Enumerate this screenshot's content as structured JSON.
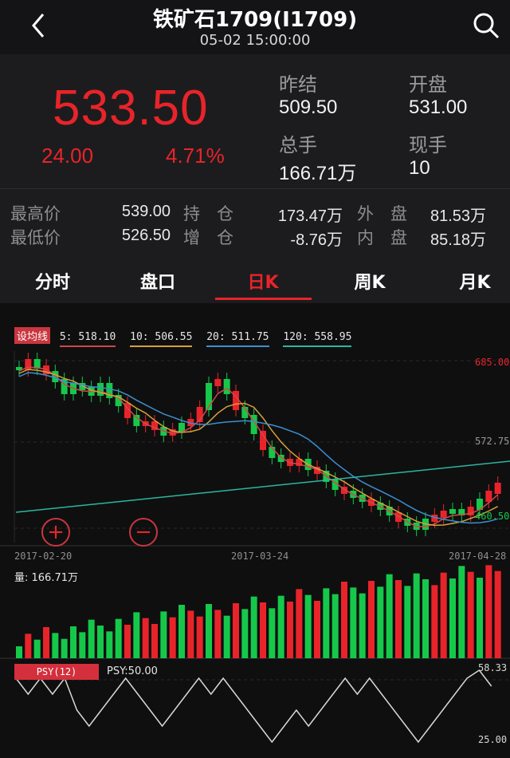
{
  "header": {
    "title": "铁矿石1709(I1709)",
    "time": "05-02 15:00:00"
  },
  "quote": {
    "price": "533.50",
    "change": "24.00",
    "change_pct": "4.71%",
    "prev_settle_label": "昨结",
    "prev_settle": "509.50",
    "open_label": "开盘",
    "open": "531.00",
    "volume_label": "总手",
    "volume": "166.71万",
    "last_label": "现手",
    "last": "10"
  },
  "stats": {
    "high_label": "最高价",
    "high": "539.00",
    "low_label": "最低价",
    "low": "526.50",
    "oi_label": "持　仓",
    "oi": "173.47万",
    "oi_chg_label": "增　仓",
    "oi_chg": "-8.76万",
    "outer_label": "外　盘",
    "outer": "81.53万",
    "inner_label": "内　盘",
    "inner": "85.18万"
  },
  "tabs": [
    "分时",
    "盘口",
    "日K",
    "周K",
    "月K"
  ],
  "chart": {
    "ma_button": "设均线",
    "ma5": "5: 518.10",
    "ma10": "10: 506.55",
    "ma20": "20: 511.75",
    "ma120": "120: 558.95",
    "y_high": "685.00",
    "y_mid": "572.75",
    "y_low": "460.50",
    "dates": [
      "2017-02-20",
      "2017-03-24",
      "2017-04-28"
    ],
    "vol_label": "量: 166.71万",
    "psy_label": "PSY(12)",
    "psy_value": "PSY:50.00",
    "psy_high": "58.33",
    "psy_low": "25.00"
  },
  "colors": {
    "up": "#e8242a",
    "down": "#16c84a",
    "ma5": "#d04848",
    "ma10": "#d6a13a",
    "ma20": "#3c8fd0",
    "ma120": "#2cb6a0"
  }
}
